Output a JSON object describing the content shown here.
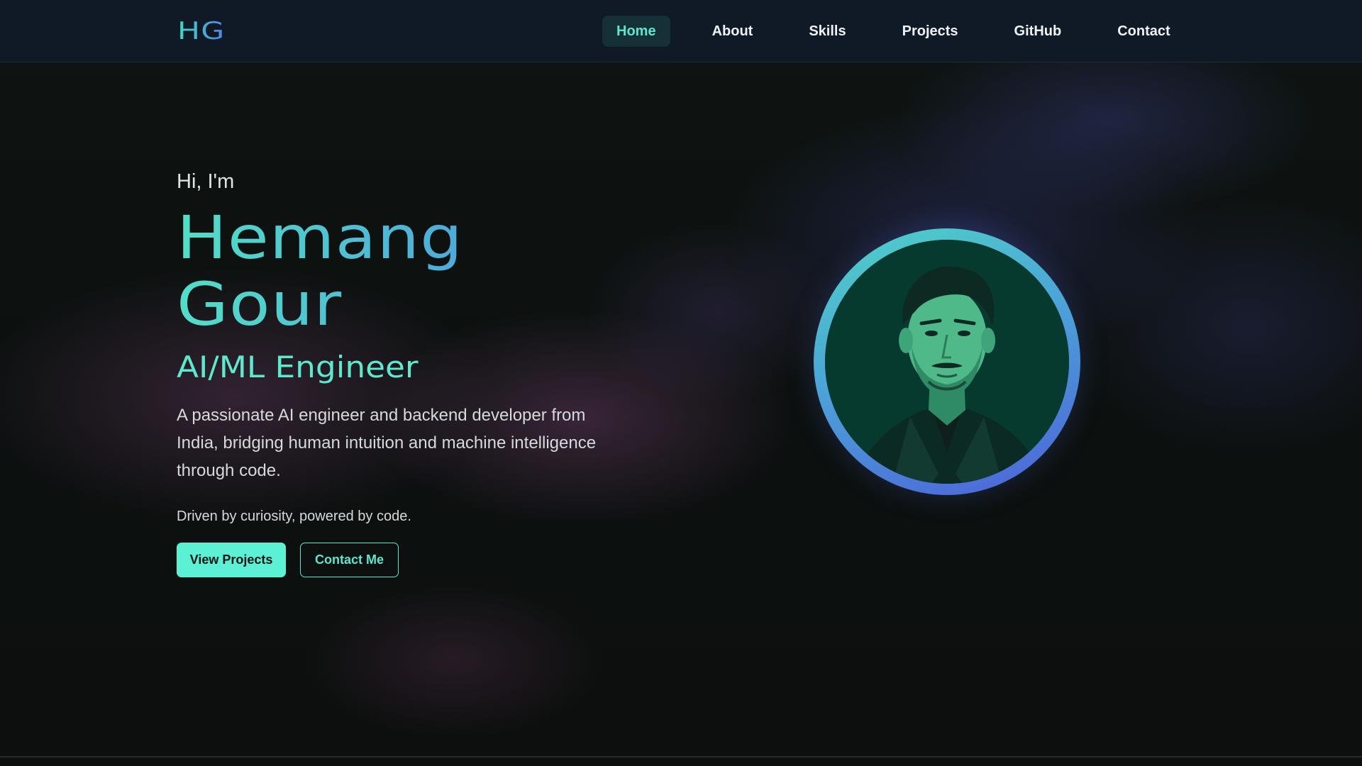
{
  "nav": {
    "logo": "HG",
    "links": [
      {
        "label": "Home",
        "active": true
      },
      {
        "label": "About",
        "active": false
      },
      {
        "label": "Skills",
        "active": false
      },
      {
        "label": "Projects",
        "active": false
      },
      {
        "label": "GitHub",
        "active": false
      },
      {
        "label": "Contact",
        "active": false
      }
    ]
  },
  "hero": {
    "greeting": "Hi, I'm",
    "name_line1": "Hemang",
    "name_line2": "Gour",
    "role": "AI/ML Engineer",
    "description": "A passionate AI engineer and backend developer from India, bridging human intuition and machine intelligence through code.",
    "tagline": "Driven by curiosity, powered by code.",
    "primary_button": "View Projects",
    "secondary_button": "Contact Me"
  },
  "colors": {
    "accent": "#5cf0d4",
    "gradient_start": "#46d8c4",
    "gradient_end": "#4d5fd9",
    "nav_background": "#0f1a26",
    "page_background": "#0c100f"
  },
  "avatar": {
    "icon": "profile-portrait"
  }
}
